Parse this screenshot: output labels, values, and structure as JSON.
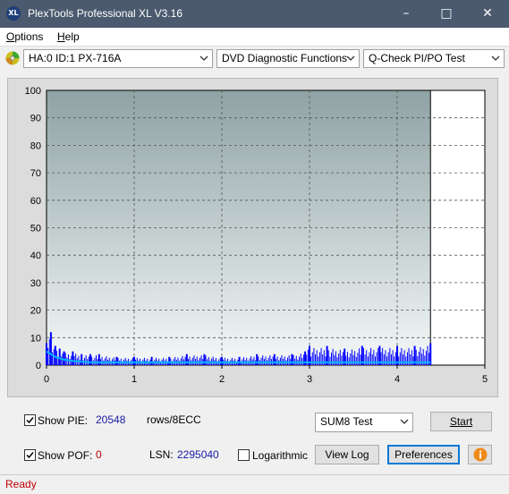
{
  "window": {
    "title": "PlexTools Professional XL V3.16",
    "icon_text": "XL"
  },
  "menu": {
    "options": "ptions",
    "options_key": "O",
    "help_key": "H",
    "help": "elp"
  },
  "toolbar": {
    "drive": "HA:0 ID:1  PX-716A",
    "function": "DVD Diagnostic Functions",
    "test": "Q-Check PI/PO Test"
  },
  "chart_data": {
    "type": "bar",
    "title": "",
    "xlabel": "",
    "ylabel": "",
    "xlim": [
      0,
      5
    ],
    "ylim": [
      0,
      100
    ],
    "x_ticks": [
      "0",
      "1",
      "2",
      "3",
      "4",
      "5"
    ],
    "y_ticks": [
      "0",
      "10",
      "20",
      "30",
      "40",
      "50",
      "60",
      "70",
      "80",
      "90",
      "100"
    ],
    "grid": true,
    "end_marker_x": 4.38,
    "series": [
      {
        "color": "#0000ff",
        "kind": "PIE spikes",
        "x": [
          0.0,
          0.05,
          0.1,
          0.15,
          0.2,
          0.3,
          0.4,
          0.5,
          0.6,
          0.8,
          1.0,
          1.2,
          1.4,
          1.6,
          1.8,
          2.0,
          2.2,
          2.4,
          2.6,
          2.8,
          2.95,
          3.0,
          3.2,
          3.4,
          3.6,
          3.8,
          4.0,
          4.2,
          4.38
        ],
        "y": [
          8,
          12,
          7,
          6,
          5,
          5,
          4,
          4,
          4,
          3,
          3,
          3,
          3,
          4,
          4,
          3,
          3,
          4,
          4,
          4,
          5,
          7,
          7,
          6,
          7,
          7,
          7,
          7,
          8
        ]
      },
      {
        "color": "#00b4ff",
        "kind": "PIE average",
        "x": [
          0.0,
          0.05,
          0.1,
          0.2,
          0.3,
          0.5,
          0.7,
          1.0,
          2.0,
          3.0,
          3.5,
          4.0,
          4.38
        ],
        "y": [
          5,
          4,
          3,
          2,
          1.5,
          1,
          1,
          1,
          1,
          1,
          1,
          1,
          1
        ]
      }
    ]
  },
  "stats": {
    "show_pie_label": "Show PIE:",
    "pie_value": "20548",
    "rows_label": "rows/8ECC",
    "show_pof_label": "Show POF:",
    "pof_value": "0",
    "lsn_label": "LSN:",
    "lsn_value": "2295040",
    "logarithmic_label": "Logarithmic",
    "test_select": "SUM8 Test"
  },
  "buttons": {
    "start": "Start",
    "view_log": "View Log",
    "preferences": "Preferences"
  },
  "status": {
    "text": "Ready"
  }
}
